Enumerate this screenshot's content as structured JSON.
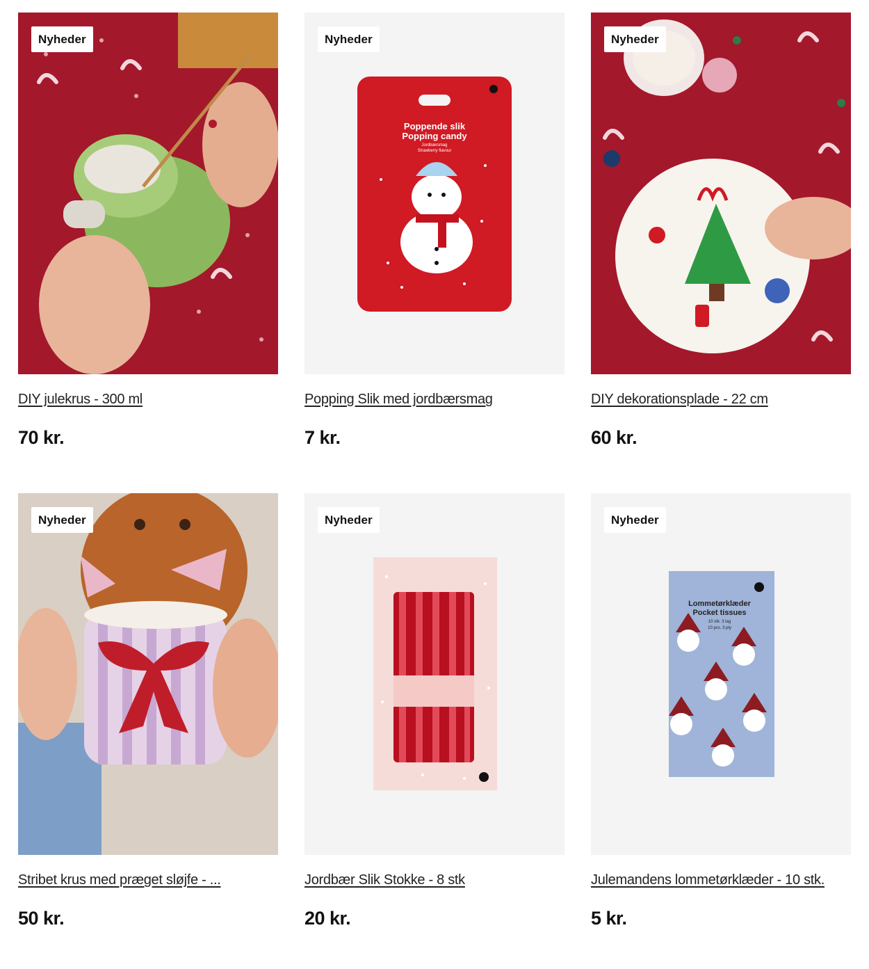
{
  "products": [
    {
      "badge": "Nyheder",
      "title": "DIY julekrus - 300 ml",
      "price": "70 kr."
    },
    {
      "badge": "Nyheder",
      "title": "Popping Slik med jordbærsmag",
      "price": "7 kr.",
      "package_text": {
        "line1": "Poppende slik",
        "line2": "Popping candy",
        "line3": "Jordbærsmag",
        "line4": "Strawberry flavour"
      }
    },
    {
      "badge": "Nyheder",
      "title": "DIY dekorationsplade - 22 cm",
      "price": "60 kr."
    },
    {
      "badge": "Nyheder",
      "title": "Stribet krus med præget sløjfe - ...",
      "price": "50 kr."
    },
    {
      "badge": "Nyheder",
      "title": "Jordbær Slik Stokke - 8 stk",
      "price": "20 kr."
    },
    {
      "badge": "Nyheder",
      "title": "Julemandens lommetørklæder - 10 stk.",
      "price": "5 kr.",
      "package_text": {
        "line1": "Lommetørklæder",
        "line2": "Pocket tissues",
        "line3": "10 stk. 3 lag",
        "line4": "10 pcs. 3 ply"
      }
    }
  ],
  "colors": {
    "accent_red": "#b0192b",
    "panel_bg": "#f3f4f3"
  }
}
